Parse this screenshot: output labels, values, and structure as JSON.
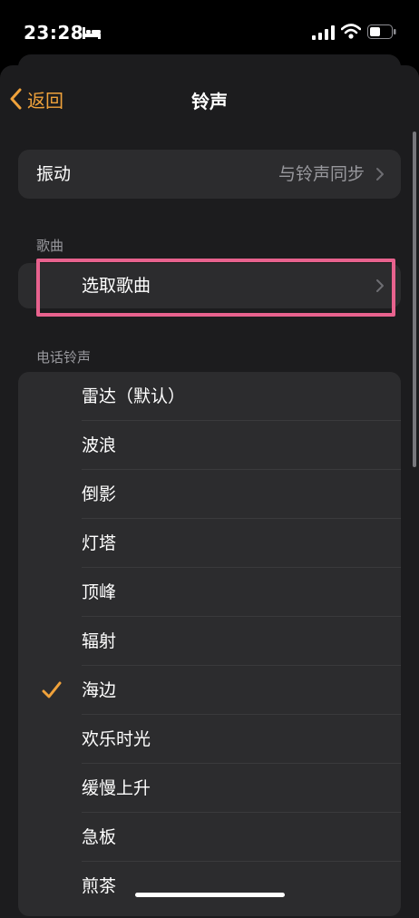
{
  "status": {
    "time": "23:28"
  },
  "nav": {
    "back_label": "返回",
    "title": "铃声"
  },
  "vibration": {
    "label": "振动",
    "value": "与铃声同步"
  },
  "songs_section": {
    "header": "歌曲",
    "pick_song_label": "选取歌曲"
  },
  "ringtones_section": {
    "header": "电话铃声",
    "items": [
      {
        "label": "雷达（默认）",
        "selected": false
      },
      {
        "label": "波浪",
        "selected": false
      },
      {
        "label": "倒影",
        "selected": false
      },
      {
        "label": "灯塔",
        "selected": false
      },
      {
        "label": "顶峰",
        "selected": false
      },
      {
        "label": "辐射",
        "selected": false
      },
      {
        "label": "海边",
        "selected": true
      },
      {
        "label": "欢乐时光",
        "selected": false
      },
      {
        "label": "缓慢上升",
        "selected": false
      },
      {
        "label": "急板",
        "selected": false
      },
      {
        "label": "煎茶",
        "selected": false
      }
    ]
  },
  "colors": {
    "accent": "#f0a23b",
    "highlight": "#e8628e",
    "background": "#1c1c1e",
    "cell": "#2c2c2e"
  }
}
